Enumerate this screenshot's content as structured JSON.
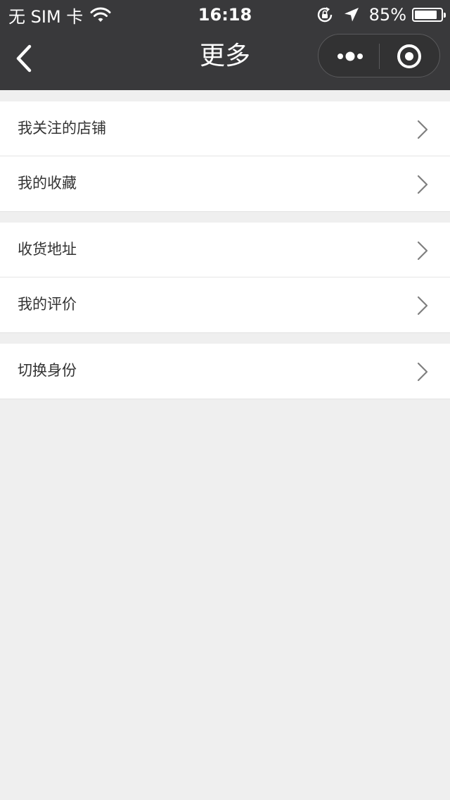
{
  "status_bar": {
    "carrier": "无 SIM 卡",
    "time": "16:18",
    "battery_percent": "85%",
    "battery_level": 0.85,
    "icons": [
      "wifi-icon",
      "orientation-lock-icon",
      "location-arrow-icon",
      "battery-icon"
    ]
  },
  "nav": {
    "title": "更多",
    "back_icon": "chevron-left-icon",
    "more_icon": "more-dots-icon",
    "close_icon": "target-circle-icon"
  },
  "groups": [
    {
      "items": [
        {
          "label": "我关注的店铺"
        },
        {
          "label": "我的收藏"
        }
      ]
    },
    {
      "items": [
        {
          "label": "收货地址"
        },
        {
          "label": "我的评价"
        }
      ]
    },
    {
      "items": [
        {
          "label": "切换身份"
        }
      ]
    }
  ],
  "colors": {
    "header_bg": "#39393b",
    "page_bg": "#efefef",
    "item_bg": "#ffffff",
    "label_text": "#333333",
    "chevron": "#7f7f7f"
  }
}
